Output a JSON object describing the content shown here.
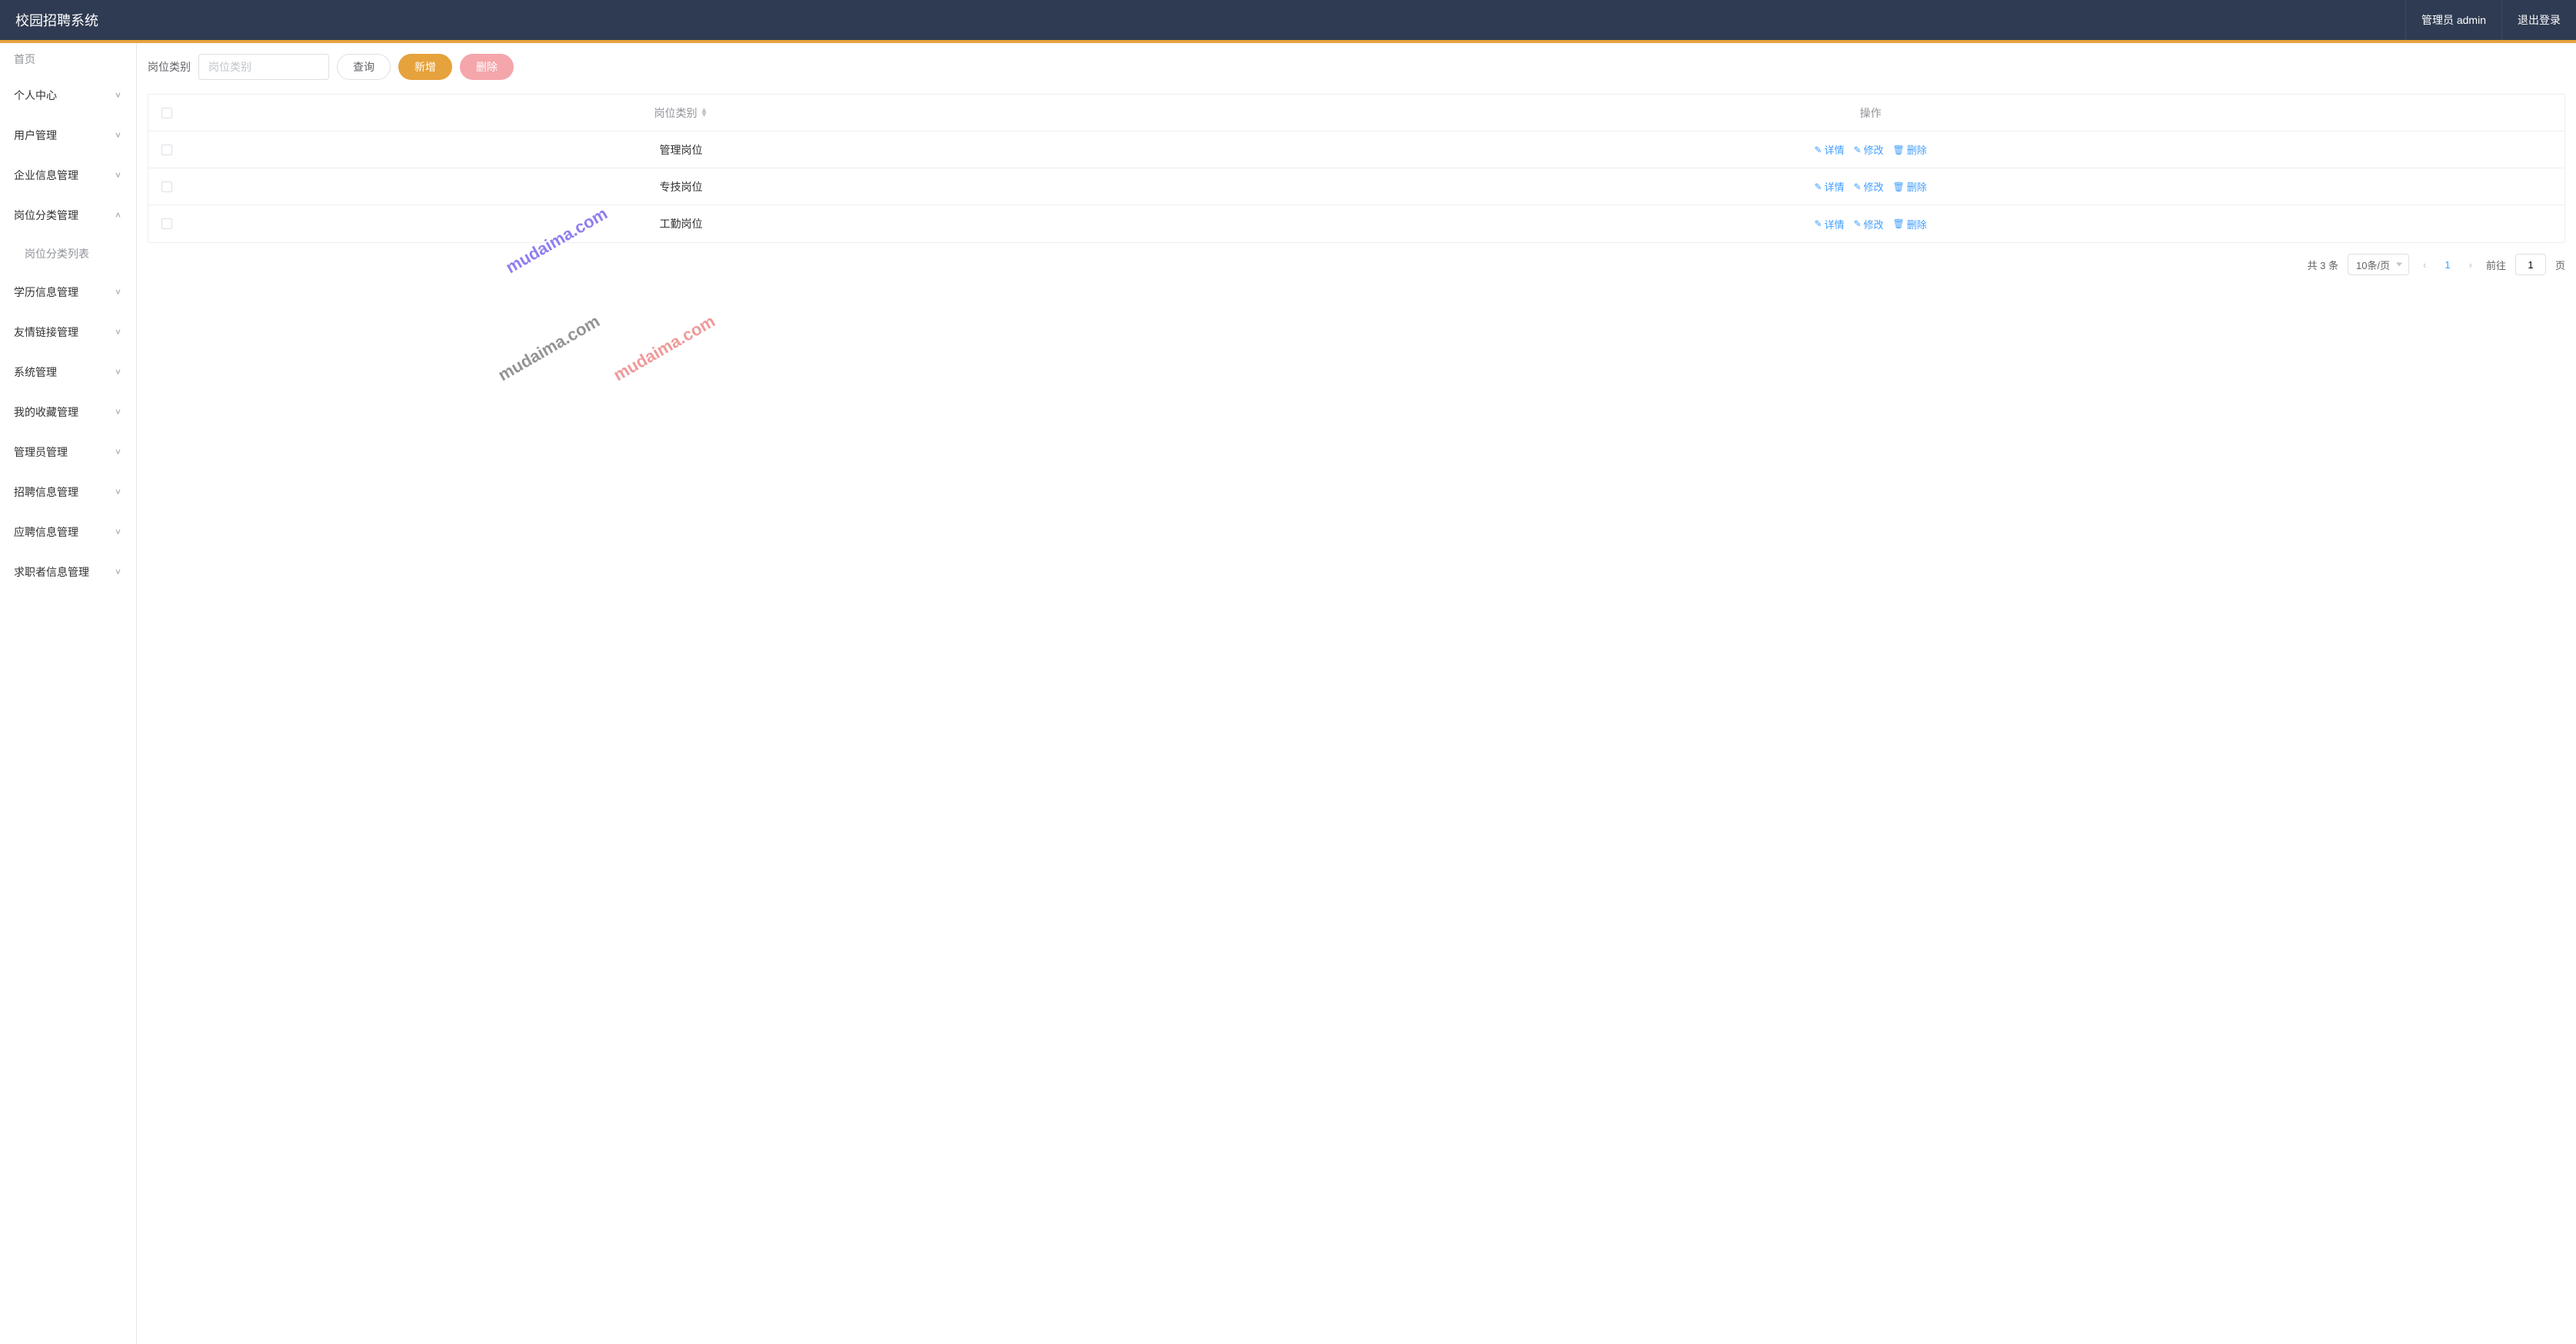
{
  "header": {
    "title": "校园招聘系统",
    "user": "管理员 admin",
    "logout": "退出登录"
  },
  "sidebar": {
    "home": "首页",
    "items": [
      {
        "label": "个人中心",
        "expanded": false
      },
      {
        "label": "用户管理",
        "expanded": false
      },
      {
        "label": "企业信息管理",
        "expanded": false
      },
      {
        "label": "岗位分类管理",
        "expanded": true,
        "children": [
          {
            "label": "岗位分类列表"
          }
        ]
      },
      {
        "label": "学历信息管理",
        "expanded": false
      },
      {
        "label": "友情链接管理",
        "expanded": false
      },
      {
        "label": "系统管理",
        "expanded": false
      },
      {
        "label": "我的收藏管理",
        "expanded": false
      },
      {
        "label": "管理员管理",
        "expanded": false
      },
      {
        "label": "招聘信息管理",
        "expanded": false
      },
      {
        "label": "应聘信息管理",
        "expanded": false
      },
      {
        "label": "求职者信息管理",
        "expanded": false
      }
    ]
  },
  "filter": {
    "label": "岗位类别",
    "placeholder": "岗位类别",
    "search": "查询",
    "add": "新增",
    "delete": "删除"
  },
  "table": {
    "headers": {
      "category": "岗位类别",
      "actions": "操作"
    },
    "rows": [
      {
        "category": "管理岗位"
      },
      {
        "category": "专技岗位"
      },
      {
        "category": "工勤岗位"
      }
    ],
    "actions": {
      "detail": "详情",
      "edit": "修改",
      "delete": "删除"
    }
  },
  "pagination": {
    "total_text": "共 3 条",
    "page_size": "10条/页",
    "current": "1",
    "goto_label": "前往",
    "goto_value": "1",
    "page_suffix": "页"
  },
  "watermark": "mudaima.com"
}
